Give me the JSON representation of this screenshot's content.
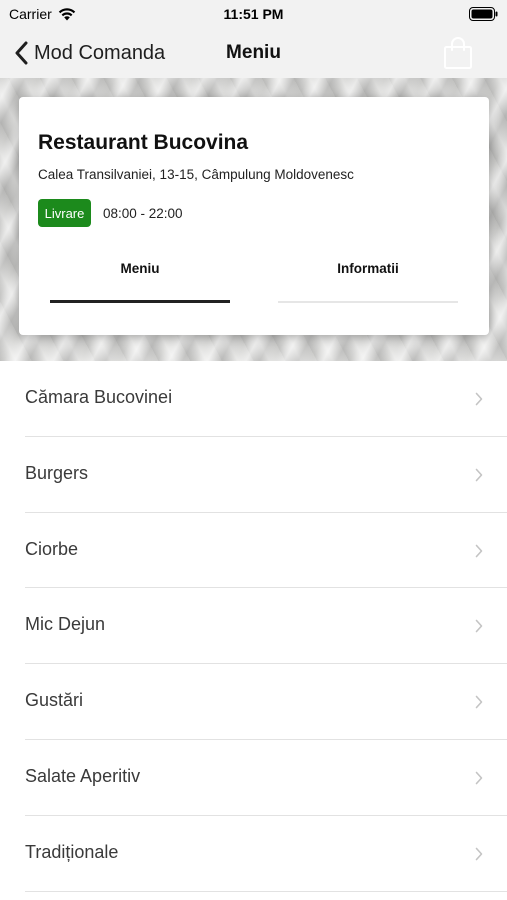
{
  "status_bar": {
    "carrier": "Carrier",
    "time": "11:51 PM"
  },
  "nav": {
    "back_label": "Mod Comanda",
    "title": "Meniu",
    "cart_icon": "shopping-bag-icon"
  },
  "restaurant": {
    "name": "Restaurant Bucovina",
    "address": "Calea Transilvaniei, 13-15, Câmpulung Moldovenesc",
    "delivery_badge": "Livrare",
    "hours": "08:00 - 22:00"
  },
  "tabs": [
    {
      "label": "Meniu",
      "active": true
    },
    {
      "label": "Informatii",
      "active": false
    }
  ],
  "categories": [
    {
      "label": "Cămara Bucovinei"
    },
    {
      "label": "Burgers"
    },
    {
      "label": "Ciorbe"
    },
    {
      "label": "Mic Dejun"
    },
    {
      "label": "Gustări"
    },
    {
      "label": "Salate Aperitiv"
    },
    {
      "label": "Tradiționale"
    }
  ],
  "colors": {
    "badge_green": "#1c8a1c",
    "nav_background": "#f2f2f2",
    "active_tab_underline": "#222222"
  }
}
